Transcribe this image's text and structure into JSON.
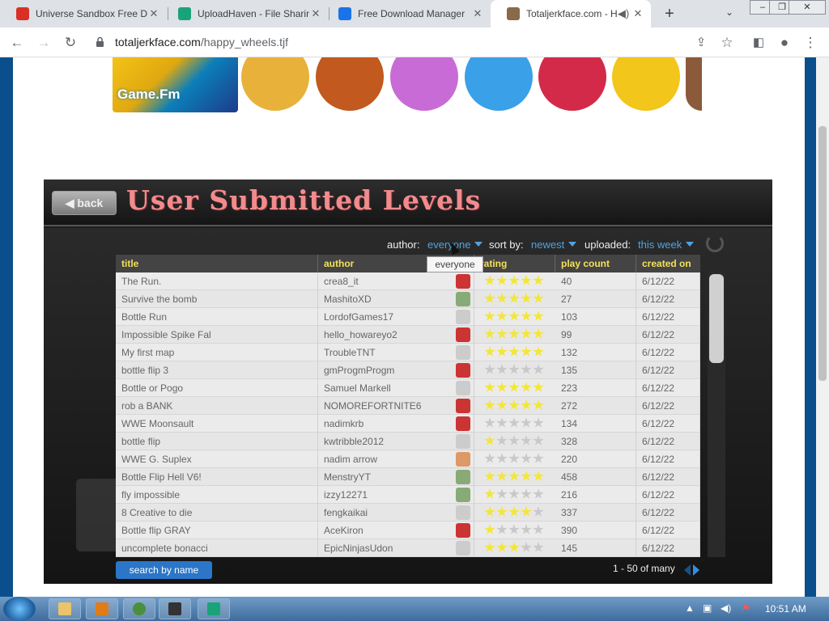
{
  "browser": {
    "tabs": [
      {
        "title": "Universe Sandbox Free D",
        "fav_color": "#d93025"
      },
      {
        "title": "UploadHaven - File Sharin",
        "fav_color": "#1aa37a"
      },
      {
        "title": "Free Download Manager",
        "fav_color": "#1a73e8"
      },
      {
        "title": "Totaljerkface.com - H",
        "fav_color": "#8a6a4a",
        "active": true
      }
    ],
    "new_tab": "+",
    "tab_menu": "⌄",
    "window_buttons": [
      "–",
      "❐",
      "✕"
    ],
    "url_host": "totaljerkface.com",
    "url_path": "/happy_wheels.tjf"
  },
  "banner": {
    "logo_text": "Game.Fm",
    "thumb_colors": [
      "#e8b23a",
      "#d65a2a",
      "#c2591e",
      "#c96bd6",
      "#3aa0e8",
      "#d42a4a",
      "#f2c61a",
      "#8a5a3a"
    ]
  },
  "game": {
    "back_label": "back",
    "title": "User Submitted Levels",
    "filters": {
      "author_label": "author:",
      "author_value": "everyone",
      "sort_label": "sort by:",
      "sort_value": "newest",
      "uploaded_label": "uploaded:",
      "uploaded_value": "this week"
    },
    "tooltip": "everyone",
    "columns": [
      "title",
      "author",
      "rating",
      "play count",
      "created on"
    ],
    "rows": [
      {
        "title": "The Run.",
        "author": "crea8_it",
        "avatar": "#c33",
        "rating": 5,
        "plays": "40",
        "date": "6/12/22"
      },
      {
        "title": "Survive the bomb",
        "author": "MashitoXD",
        "avatar": "#8a7",
        "rating": 5,
        "plays": "27",
        "date": "6/12/22"
      },
      {
        "title": "Bottle Run",
        "author": "LordofGames17",
        "avatar": "#ccc",
        "rating": 5,
        "plays": "103",
        "date": "6/12/22"
      },
      {
        "title": "Impossible Spike Fal",
        "author": "hello_howareyo2",
        "avatar": "#c33",
        "rating": 5,
        "plays": "99",
        "date": "6/12/22"
      },
      {
        "title": "My first map",
        "author": "TroubleTNT",
        "avatar": "#ccc",
        "rating": 5,
        "plays": "132",
        "date": "6/12/22"
      },
      {
        "title": "bottle flip 3",
        "author": "gmProgmProgm",
        "avatar": "#c33",
        "rating": 0,
        "plays": "135",
        "date": "6/12/22"
      },
      {
        "title": "Bottle or Pogo",
        "author": "Samuel Markell",
        "avatar": "#ccc",
        "rating": 5,
        "plays": "223",
        "date": "6/12/22"
      },
      {
        "title": "rob a BANK",
        "author": "NOMOREFORTNITE6",
        "avatar": "#c33",
        "rating": 5,
        "plays": "272",
        "date": "6/12/22"
      },
      {
        "title": "WWE  Moonsault",
        "author": "nadimkrb",
        "avatar": "#c33",
        "rating": 0,
        "plays": "134",
        "date": "6/12/22"
      },
      {
        "title": "bottle flip",
        "author": "kwtribble2012",
        "avatar": "#ccc",
        "rating": 1,
        "plays": "328",
        "date": "6/12/22"
      },
      {
        "title": "WWE G. Suplex",
        "author": "nadim arrow",
        "avatar": "#d96",
        "rating": 0,
        "plays": "220",
        "date": "6/12/22"
      },
      {
        "title": "Bottle Flip Hell V6!",
        "author": "MenstryYT",
        "avatar": "#8a7",
        "rating": 5,
        "plays": "458",
        "date": "6/12/22"
      },
      {
        "title": "fly impossible",
        "author": "izzy12271",
        "avatar": "#8a7",
        "rating": 1,
        "plays": "216",
        "date": "6/12/22"
      },
      {
        "title": "8 Creative to die",
        "author": "fengkaikai",
        "avatar": "#ccc",
        "rating": 3.5,
        "plays": "337",
        "date": "6/12/22"
      },
      {
        "title": "Bottle flip GRAY",
        "author": "AceKiron",
        "avatar": "#c33",
        "rating": 0.5,
        "plays": "390",
        "date": "6/12/22"
      },
      {
        "title": "uncomplete bonacci",
        "author": "EpicNinjasUdon",
        "avatar": "#ccc",
        "rating": 2.5,
        "plays": "145",
        "date": "6/12/22"
      }
    ],
    "search_button": "search by name",
    "pager_text": "1 - 50 of many"
  },
  "taskbar": {
    "apps": [
      "#e9c46a",
      "#e07b1a",
      "#4a8f3c",
      "#333333",
      "#1aa37a"
    ],
    "clock": "10:51 AM"
  }
}
